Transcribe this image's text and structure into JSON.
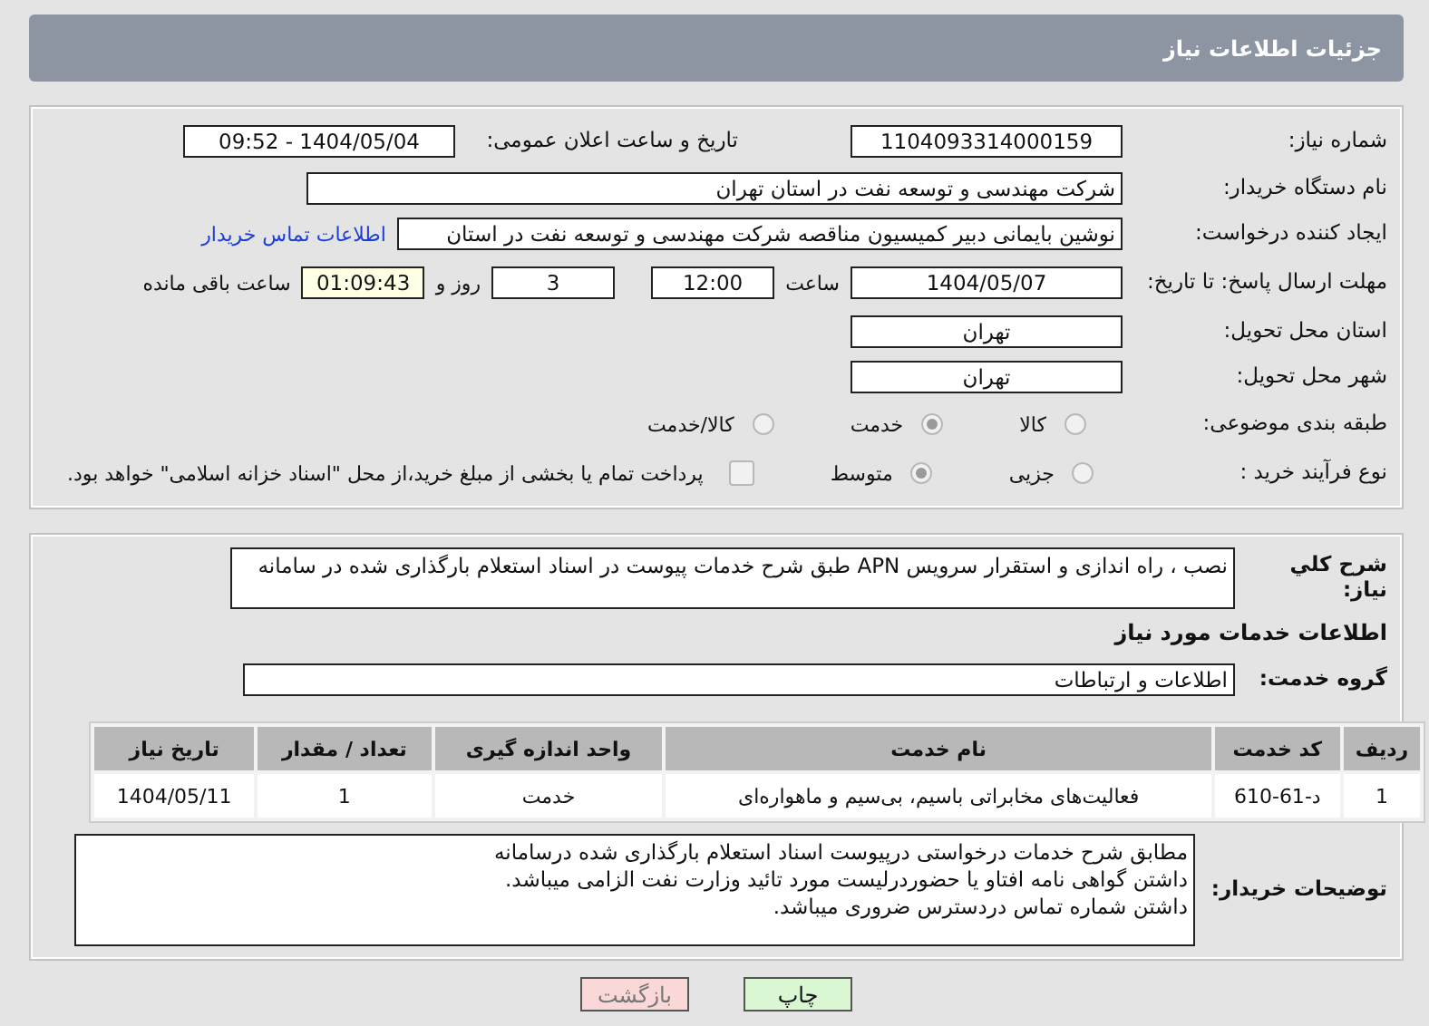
{
  "header": {
    "title": "جزئیات اطلاعات نیاز"
  },
  "details": {
    "need_number": {
      "label": "شماره نیاز:",
      "value": "1104093314000159"
    },
    "announce_date": {
      "label": "تاریخ و ساعت اعلان عمومی:",
      "value": "1404/05/04 - 09:52"
    },
    "buyer": {
      "label": "نام دستگاه خریدار:",
      "value": "شرکت مهندسی و توسعه نفت در استان تهران"
    },
    "requester": {
      "label": "ایجاد کننده درخواست:",
      "value": "نوشین بایمانی دبیر کمیسیون مناقصه شرکت مهندسی و توسعه نفت در استان",
      "link": "اطلاعات تماس خریدار"
    },
    "deadline": {
      "label": "مهلت ارسال پاسخ: تا تاریخ:",
      "date": "1404/05/07",
      "time_label": "ساعت",
      "time": "12:00",
      "days": "3",
      "days_label": "روز و",
      "remaining": "01:09:43",
      "remaining_label": "ساعت باقی مانده"
    },
    "province": {
      "label": "استان محل تحویل:",
      "value": "تهران"
    },
    "city": {
      "label": "شهر محل تحویل:",
      "value": "تهران"
    },
    "category": {
      "label": "طبقه بندی موضوعی:",
      "options": [
        {
          "label": "کالا",
          "selected": false
        },
        {
          "label": "خدمت",
          "selected": true
        },
        {
          "label": "کالا/خدمت",
          "selected": false
        }
      ]
    },
    "purchase_type": {
      "label": "نوع فرآیند خرید :",
      "options": [
        {
          "label": "جزیی",
          "selected": false
        },
        {
          "label": "متوسط",
          "selected": true
        }
      ],
      "payment": {
        "label": "پرداخت تمام یا بخشی از مبلغ خرید،از محل \"اسناد خزانه اسلامی\" خواهد بود.",
        "checked": false
      }
    }
  },
  "need": {
    "description_label": "شرح کلي نیاز:",
    "description": "نصب ، راه اندازی و استقرار سرویس APN طبق شرح خدمات پیوست در اسناد استعلام بارگذاری شده در سامانه",
    "services_heading": "اطلاعات خدمات مورد نیاز",
    "group_label": "گروه خدمت:",
    "group": "اطلاعات و ارتباطات",
    "table": {
      "columns": [
        "ردیف",
        "کد خدمت",
        "نام خدمت",
        "واحد اندازه گیری",
        "تعداد / مقدار",
        "تاریخ نیاز"
      ],
      "rows": [
        [
          "1",
          "د-61-610",
          "فعالیت‌های مخابراتی باسیم، بی‌سیم و ماهواره‌ای",
          "خدمت",
          "1",
          "1404/05/11"
        ]
      ]
    },
    "notes_label": "توضیحات خریدار:",
    "notes": [
      "مطابق شرح خدمات درخواستی درپیوست اسناد استعلام بارگذاری شده درسامانه",
      "داشتن گواهی نامه افتاو یا حضوردرلیست مورد تائید وزارت نفت الزامی میباشد.",
      "داشتن شماره تماس دردسترس ضروری میباشد."
    ]
  },
  "buttons": [
    {
      "label": "چاپ",
      "kind": "print"
    },
    {
      "label": "بازگشت",
      "kind": "back"
    }
  ]
}
